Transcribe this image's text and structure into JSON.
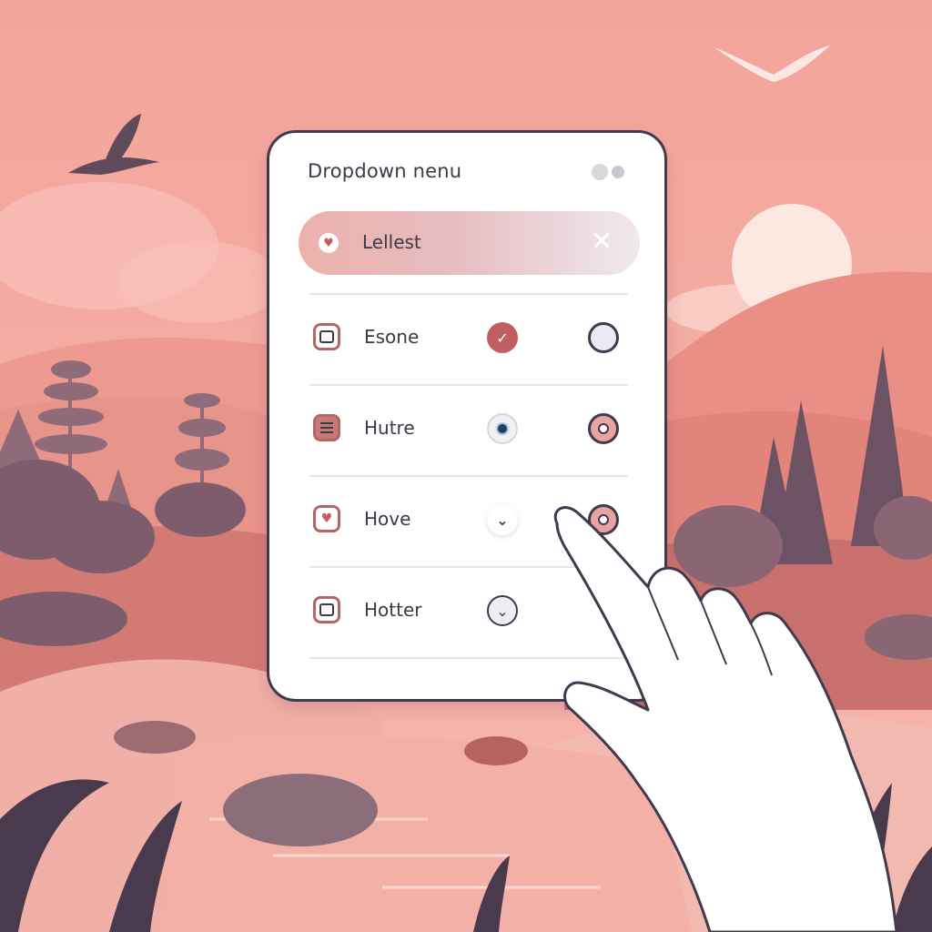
{
  "menu": {
    "title": "Dropdown nenu",
    "search": {
      "value": "Lellest",
      "clear_icon": "close-icon"
    },
    "items": [
      {
        "label": "Esone",
        "left_icon": "checkbox-icon",
        "middle_icon": "check-circle-icon",
        "right_icon": "radio-empty-icon"
      },
      {
        "label": "Hutre",
        "left_icon": "list-icon",
        "middle_icon": "camera-icon",
        "right_icon": "radio-selected-icon"
      },
      {
        "label": "Hove",
        "left_icon": "heart-icon",
        "middle_icon": "chevron-down-icon",
        "right_icon": "radio-selected-icon"
      },
      {
        "label": "Hotter",
        "left_icon": "checkbox-icon",
        "middle_icon": "chevron-down-circle-icon",
        "right_icon": ""
      }
    ]
  },
  "colors": {
    "background": "#f3a99f",
    "accent": "#b56566",
    "ink": "#3f3a4d"
  }
}
